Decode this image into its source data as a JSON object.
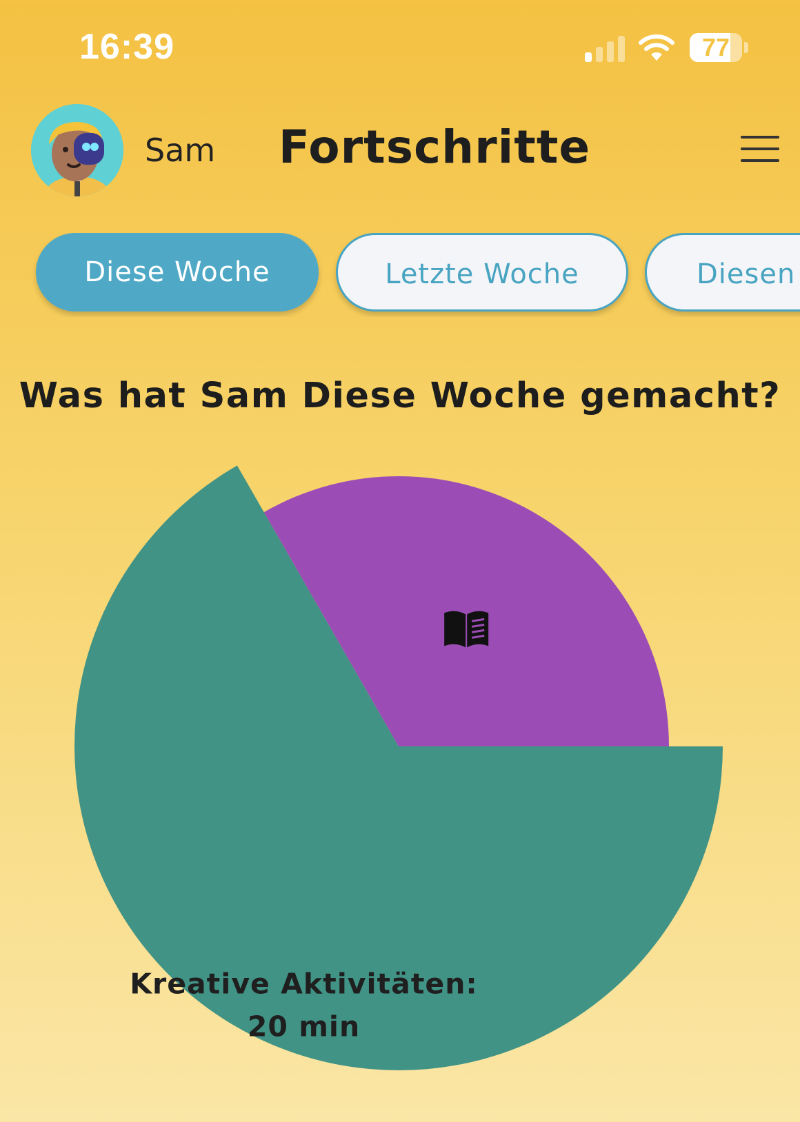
{
  "status_bar": {
    "time": "16:39",
    "signal_bars_active": 1,
    "signal_bars_total": 4,
    "wifi_icon": "wifi-icon",
    "battery_level": "77",
    "battery_fraction": 0.77
  },
  "header": {
    "avatar_icon": "user-avatar",
    "user_name": "Sam",
    "title": "Fortschritte",
    "menu_icon": "hamburger-menu-icon"
  },
  "tabs": [
    {
      "label": "Diese Woche",
      "active": true
    },
    {
      "label": "Letzte Woche",
      "active": false
    },
    {
      "label": "Diesen",
      "active": false
    }
  ],
  "question": "Was hat Sam Diese Woche gemacht?",
  "chart_data": {
    "type": "pie",
    "title": "",
    "slices": [
      {
        "label": "Kreative Aktivitäten",
        "display": "Kreative Aktivitäten:",
        "value_label": "20 min",
        "share": 0.667,
        "color": "#419386",
        "highlighted": true,
        "icon": ""
      },
      {
        "label": "",
        "display": "",
        "value_label": "",
        "share": 0.333,
        "color": "#9b4db5",
        "highlighted": false,
        "icon": "book-open-icon"
      }
    ]
  }
}
